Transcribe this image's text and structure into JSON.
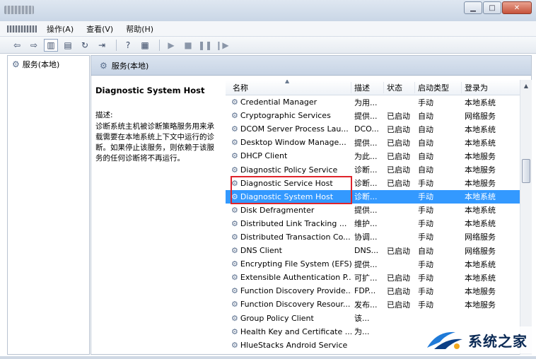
{
  "menu": [
    "操作(A)",
    "查看(V)",
    "帮助(H)"
  ],
  "left_pane": {
    "tree_item": "服务(本地)"
  },
  "right_pane": {
    "header": "服务(本地)",
    "selected_title": "Diagnostic System Host",
    "desc_label": "描述:",
    "description": "诊断系统主机被诊断策略服务用来承载需要在本地系统上下文中运行的诊断。如果停止该服务，则依赖于该服务的任何诊断将不再运行。"
  },
  "columns": {
    "name": "名称",
    "desc": "描述",
    "status": "状态",
    "startup": "启动类型",
    "logon": "登录为"
  },
  "services": [
    {
      "name": "Credential Manager",
      "desc": "为用...",
      "status": "",
      "startup": "手动",
      "logon": "本地系统"
    },
    {
      "name": "Cryptographic Services",
      "desc": "提供...",
      "status": "已启动",
      "startup": "自动",
      "logon": "网络服务"
    },
    {
      "name": "DCOM Server Process Lau...",
      "desc": "DCO...",
      "status": "已启动",
      "startup": "自动",
      "logon": "本地系统"
    },
    {
      "name": "Desktop Window Manage...",
      "desc": "提供...",
      "status": "已启动",
      "startup": "自动",
      "logon": "本地系统"
    },
    {
      "name": "DHCP Client",
      "desc": "为此...",
      "status": "已启动",
      "startup": "自动",
      "logon": "本地服务"
    },
    {
      "name": "Diagnostic Policy Service",
      "desc": "诊断...",
      "status": "已启动",
      "startup": "自动",
      "logon": "本地服务"
    },
    {
      "name": "Diagnostic Service Host",
      "desc": "诊断...",
      "status": "已启动",
      "startup": "手动",
      "logon": "本地服务"
    },
    {
      "name": "Diagnostic System Host",
      "desc": "诊断...",
      "status": "",
      "startup": "手动",
      "logon": "本地系统"
    },
    {
      "name": "Disk Defragmenter",
      "desc": "提供...",
      "status": "",
      "startup": "手动",
      "logon": "本地系统"
    },
    {
      "name": "Distributed Link Tracking ...",
      "desc": "维护...",
      "status": "",
      "startup": "手动",
      "logon": "本地系统"
    },
    {
      "name": "Distributed Transaction Co...",
      "desc": "协调...",
      "status": "",
      "startup": "手动",
      "logon": "网络服务"
    },
    {
      "name": "DNS Client",
      "desc": "DNS...",
      "status": "已启动",
      "startup": "自动",
      "logon": "网络服务"
    },
    {
      "name": "Encrypting File System (EFS)",
      "desc": "提供...",
      "status": "",
      "startup": "手动",
      "logon": "本地系统"
    },
    {
      "name": "Extensible Authentication P...",
      "desc": "可扩...",
      "status": "已启动",
      "startup": "手动",
      "logon": "本地系统"
    },
    {
      "name": "Function Discovery Provide...",
      "desc": "FDP...",
      "status": "已启动",
      "startup": "手动",
      "logon": "本地服务"
    },
    {
      "name": "Function Discovery Resour...",
      "desc": "发布...",
      "status": "已启动",
      "startup": "手动",
      "logon": "本地服务"
    },
    {
      "name": "Group Policy Client",
      "desc": "该...",
      "status": "",
      "startup": "",
      "logon": ""
    },
    {
      "name": "Health Key and Certificate ...",
      "desc": "为...",
      "status": "",
      "startup": "",
      "logon": ""
    },
    {
      "name": "HlueStacks Android Service",
      "desc": "",
      "status": "",
      "startup": "",
      "logon": ""
    }
  ],
  "selected_index": 7,
  "watermark": "系统之家",
  "accent_color": "#3399ff",
  "highlight_color": "#e0232a"
}
